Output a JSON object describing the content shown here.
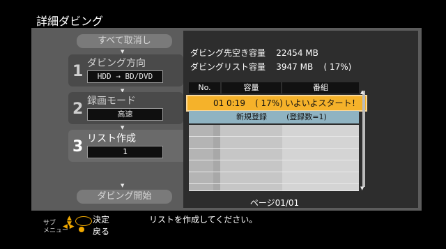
{
  "title": "詳細ダビング",
  "left": {
    "clear_all": "すべて取消し",
    "steps": [
      {
        "num": "1",
        "label": "ダビング方向",
        "value": "HDD → BD/DVD"
      },
      {
        "num": "2",
        "label": "録画モード",
        "value": "高速"
      },
      {
        "num": "3",
        "label": "リスト作成",
        "value": "1"
      }
    ],
    "start": "ダビング開始",
    "arrow_glyph": "▼",
    "active_marker": "◀"
  },
  "capacity": {
    "free_label": "ダビング先空き容量",
    "free_value": "22454 MB",
    "list_label": "ダビングリスト容量",
    "list_value": "3947 MB",
    "list_percent": "( 17%)"
  },
  "table": {
    "headers": [
      "No.",
      "容量",
      "番組"
    ],
    "selected": {
      "no": "01",
      "time": "0:19",
      "percent": "( 17%)",
      "title": "いよいよスタート！"
    },
    "new_entry": {
      "label": "新規登録",
      "count": "(登録数=1)"
    }
  },
  "page_indicator": "ページ01/01",
  "footer": {
    "sub_menu": "サブ\nメニュー",
    "ok": "決定",
    "back": "戻る",
    "message": "リストを作成してください。"
  },
  "colors": {
    "selected_row": "#f5b22a",
    "new_row": "#8fb3c2",
    "panel": "#5c5c5c",
    "accent": "#f0a800"
  }
}
